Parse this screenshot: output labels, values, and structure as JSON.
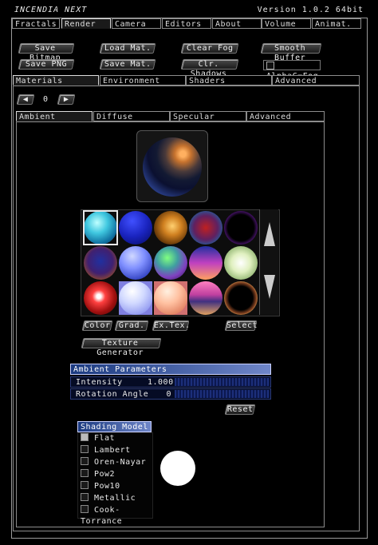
{
  "app": {
    "title": "INCENDIA NEXT",
    "version": "Version 1.0.2 64bit"
  },
  "main_tabs": [
    "Fractals",
    "Render",
    "Camera",
    "Editors",
    "About",
    "Volume",
    "Animat."
  ],
  "buttons": {
    "save_bitmap": "Save Bitmap",
    "load_mat": "Load Mat.",
    "clear_fog": "Clear Fog",
    "smooth_buffer": "Smooth Buffer",
    "save_png": "Save PNG",
    "save_mat": "Save Mat.",
    "clr_shadows": "Clr. Shadows"
  },
  "alpha_fog": {
    "label": "AlphaC=Fog",
    "checked": false
  },
  "sub_tabs": [
    "Materials",
    "Environment",
    "Shaders",
    "Advanced"
  ],
  "material_nav": {
    "index": "0"
  },
  "material_tabs": [
    "Ambient",
    "Diffuse",
    "Specular",
    "Advanced"
  ],
  "palette_buttons": {
    "color": "Color",
    "grad": "Grad.",
    "ex_tex": "Ex.Tex.",
    "select": "Select",
    "texture_generator": "Texture Generator"
  },
  "ambient_params": {
    "title": "Ambient Parameters",
    "intensity_label": "Intensity",
    "intensity_value": "1.000",
    "rotation_label": "Rotation Angle",
    "rotation_value": "0",
    "reset": "Reset"
  },
  "shading_model": {
    "title": "Shading Model",
    "options": [
      "Flat",
      "Lambert",
      "Oren-Nayar",
      "Pow2",
      "Pow10",
      "Metallic",
      "Cook-Torrance"
    ],
    "selected": "Flat"
  }
}
